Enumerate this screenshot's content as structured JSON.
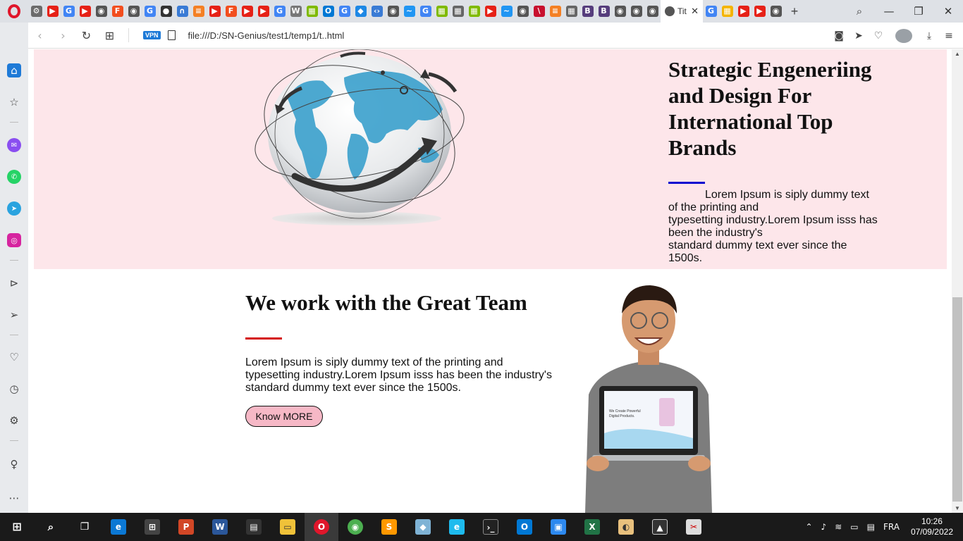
{
  "browser": {
    "active_tab_title": "Tit",
    "url": "file:///D:/SN-Genius/test1/temp1/t..html",
    "vpn_label": "VPN"
  },
  "tabs": [
    {
      "icon": "settings-icon",
      "color": "#6b6b6b",
      "glyph": "⚙"
    },
    {
      "icon": "youtube-icon",
      "color": "#e62117",
      "glyph": "▶"
    },
    {
      "icon": "google-icon",
      "color": "#4285f4",
      "glyph": "G"
    },
    {
      "icon": "youtube-icon",
      "color": "#e62117",
      "glyph": "▶"
    },
    {
      "icon": "globe-icon",
      "color": "#555555",
      "glyph": "◉"
    },
    {
      "icon": "figma-icon",
      "color": "#f24e1e",
      "glyph": "F"
    },
    {
      "icon": "globe-icon",
      "color": "#555555",
      "glyph": "◉"
    },
    {
      "icon": "google-icon",
      "color": "#4285f4",
      "glyph": "G"
    },
    {
      "icon": "app-icon",
      "color": "#333333",
      "glyph": "●"
    },
    {
      "icon": "app-icon",
      "color": "#3a7bd5",
      "glyph": "∩"
    },
    {
      "icon": "stackoverflow-icon",
      "color": "#f48024",
      "glyph": "≡"
    },
    {
      "icon": "youtube-icon",
      "color": "#e62117",
      "glyph": "▶"
    },
    {
      "icon": "figma-icon",
      "color": "#f24e1e",
      "glyph": "F"
    },
    {
      "icon": "youtube-icon",
      "color": "#e62117",
      "glyph": "▶"
    },
    {
      "icon": "youtube-icon",
      "color": "#e62117",
      "glyph": "▶"
    },
    {
      "icon": "google-icon",
      "color": "#4285f4",
      "glyph": "G"
    },
    {
      "icon": "wikipedia-icon",
      "color": "#777777",
      "glyph": "W"
    },
    {
      "icon": "microsoft-icon",
      "color": "#7fba00",
      "glyph": "▦"
    },
    {
      "icon": "outlook-icon",
      "color": "#0078d4",
      "glyph": "O"
    },
    {
      "icon": "google-icon",
      "color": "#4285f4",
      "glyph": "G"
    },
    {
      "icon": "app-icon",
      "color": "#1e88e5",
      "glyph": "◆"
    },
    {
      "icon": "code-icon",
      "color": "#3a7bd5",
      "glyph": "‹›"
    },
    {
      "icon": "globe-icon",
      "color": "#555555",
      "glyph": "◉"
    },
    {
      "icon": "app-icon",
      "color": "#2196f3",
      "glyph": "~"
    },
    {
      "icon": "google-icon",
      "color": "#4285f4",
      "glyph": "G"
    },
    {
      "icon": "microsoft-icon",
      "color": "#7fba00",
      "glyph": "▦"
    },
    {
      "icon": "grid-icon",
      "color": "#666666",
      "glyph": "▦"
    },
    {
      "icon": "microsoft-icon",
      "color": "#7fba00",
      "glyph": "▦"
    },
    {
      "icon": "youtube-icon",
      "color": "#e62117",
      "glyph": "▶"
    },
    {
      "icon": "app-icon",
      "color": "#2196f3",
      "glyph": "~"
    },
    {
      "icon": "globe-icon",
      "color": "#555555",
      "glyph": "◉"
    },
    {
      "icon": "app-icon",
      "color": "#c8102e",
      "glyph": "\\"
    },
    {
      "icon": "stackoverflow-icon",
      "color": "#f48024",
      "glyph": "≡"
    },
    {
      "icon": "grid-icon",
      "color": "#666666",
      "glyph": "▦"
    },
    {
      "icon": "bootstrap-icon",
      "color": "#563d7c",
      "glyph": "B"
    },
    {
      "icon": "bootstrap-icon",
      "color": "#563d7c",
      "glyph": "B"
    },
    {
      "icon": "globe-icon",
      "color": "#555555",
      "glyph": "◉"
    },
    {
      "icon": "globe-icon",
      "color": "#555555",
      "glyph": "◉"
    },
    {
      "icon": "globe-icon",
      "color": "#555555",
      "glyph": "◉"
    }
  ],
  "tabs_after": [
    {
      "icon": "google-icon",
      "color": "#4285f4",
      "glyph": "G"
    },
    {
      "icon": "app-icon",
      "color": "#f4b400",
      "glyph": "▦"
    },
    {
      "icon": "youtube-icon",
      "color": "#e62117",
      "glyph": "▶"
    },
    {
      "icon": "youtube-icon",
      "color": "#e62117",
      "glyph": "▶"
    },
    {
      "icon": "globe-icon",
      "color": "#555555",
      "glyph": "◉"
    }
  ],
  "hero": {
    "title": "Strategic Engeneriing and Design For International Top Brands",
    "text_lines": [
      "Lorem Ipsum is siply dummy text",
      "of the printing and",
      "typesetting industry.Lorem Ipsum isss has",
      "been the industry's",
      "standard dummy text ever since the",
      "1500s."
    ]
  },
  "team": {
    "title": "We work with the Great Team",
    "text_lines": [
      "Lorem Ipsum is siply dummy text of the printing and",
      "typesetting industry.Lorem Ipsum isss has been the industry's",
      "standard dummy text ever since the 1500s."
    ],
    "button_label": "Know MORE",
    "laptop_headline_1": "We Create Powerful",
    "laptop_headline_2": "Digital Products."
  },
  "colors": {
    "hero_bg": "#fde6ea",
    "hero_line": "#0a0ad0",
    "team_line": "#d40f0f",
    "button_bg": "#f6b8c6"
  },
  "taskbar": {
    "language": "FRA",
    "time": "10:26",
    "date": "07/09/2022"
  }
}
